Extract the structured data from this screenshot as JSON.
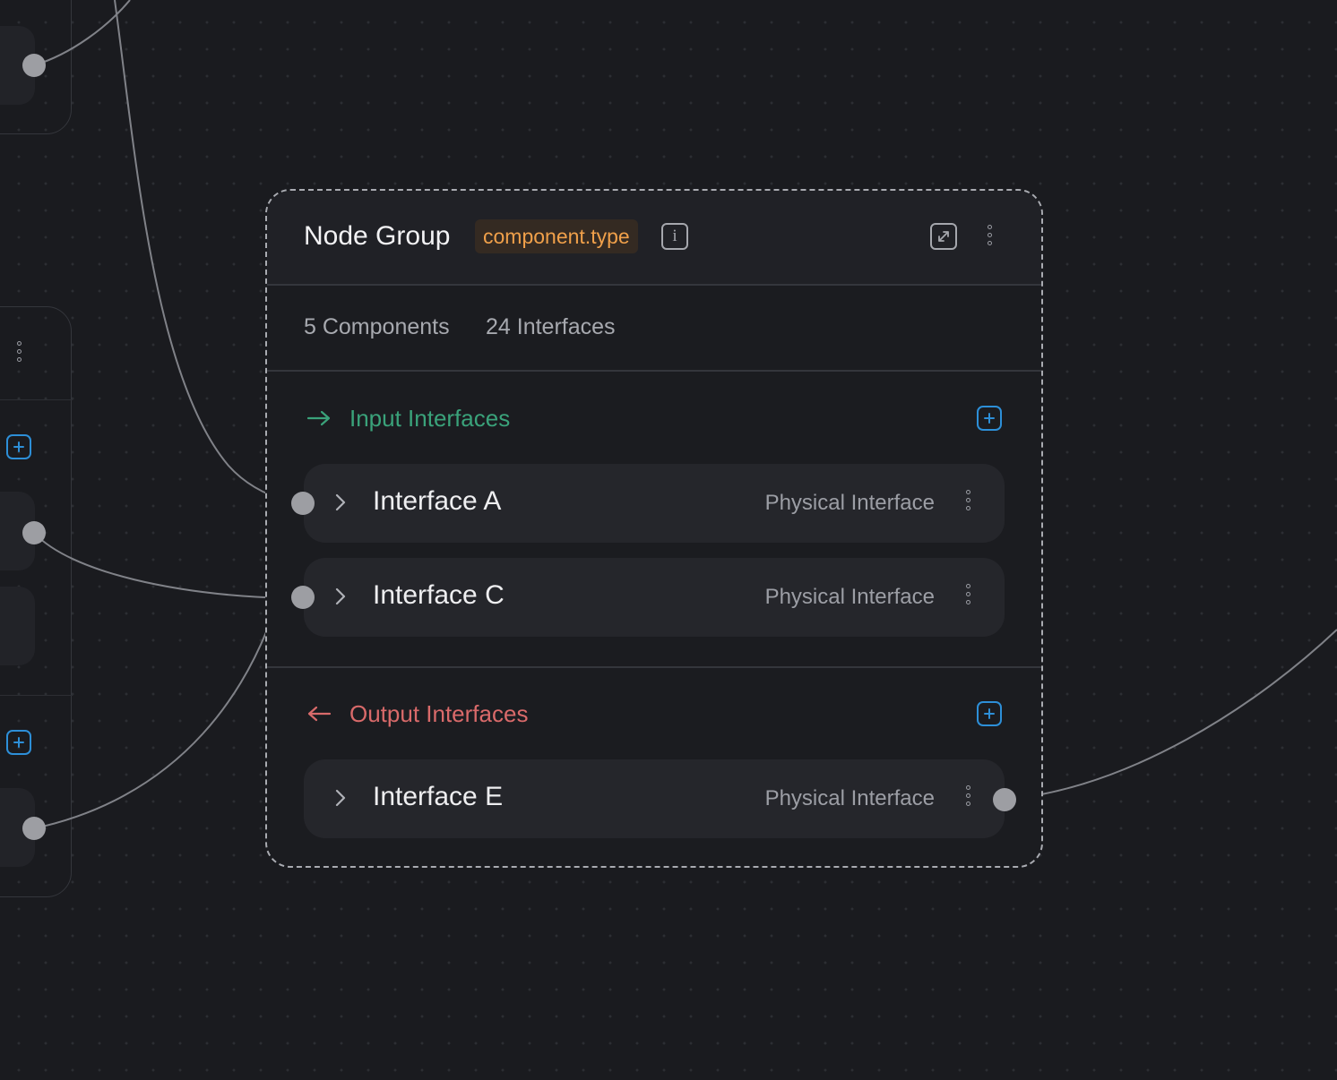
{
  "group": {
    "title": "Node Group",
    "type_badge": "component.type",
    "stats": {
      "components": "5 Components",
      "interfaces": "24 Interfaces"
    }
  },
  "input_section": {
    "title": "Input Interfaces",
    "interfaces": [
      {
        "name": "Interface A",
        "type": "Physical Interface"
      },
      {
        "name": "Interface C",
        "type": "Physical Interface"
      }
    ]
  },
  "output_section": {
    "title": "Output Interfaces",
    "interfaces": [
      {
        "name": "Interface E",
        "type": "Physical Interface"
      }
    ]
  },
  "icons": {
    "info": "info-icon",
    "expand": "expand-icon",
    "more": "more-vertical-icon",
    "add": "plus-square-icon",
    "input_arrow": "arrow-right-icon",
    "output_arrow": "arrow-left-icon",
    "chevron": "chevron-right-icon"
  },
  "colors": {
    "background": "#1a1b1f",
    "accent_input": "#3aa27a",
    "accent_output": "#d96a6a",
    "badge_text": "#f0a04a",
    "add_button": "#2d8fd8"
  }
}
